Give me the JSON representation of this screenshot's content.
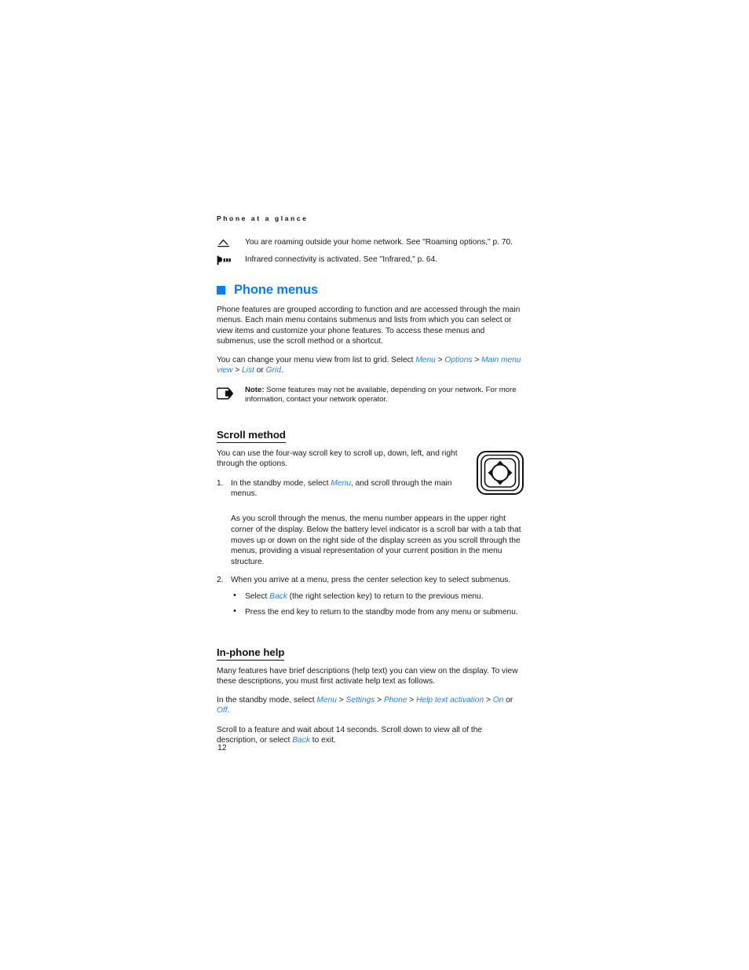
{
  "page": {
    "running_header": "Phone at a glance",
    "folio": "12"
  },
  "glance_items": [
    {
      "icon": "roaming-triangle-icon",
      "text": "You are roaming outside your home network. See \"Roaming options,\" p. 70."
    },
    {
      "icon": "infrared-icon",
      "text": "Infrared connectivity is activated. See \"Infrared,\" p. 64."
    }
  ],
  "section": {
    "title": "Phone menus",
    "bullet_color": "#0a7bf0",
    "title_color": "#0a7bf0",
    "intro": "Phone features are grouped according to function and are accessed through the main menus. Each main menu contains submenus and lists from which you can select or view items and customize your phone features. To access these menus and submenus, use the scroll method or a shortcut.",
    "menu_path_intro": "You can change your menu view from list to grid. Select ",
    "menu_path": {
      "item1": "Menu",
      "sep1": " > ",
      "item2": "Options",
      "sep2": " > ",
      "item3": "Main menu view",
      "sep3": " > ",
      "item4": "List",
      "sep4": " or ",
      "item5": "Grid",
      "end": "."
    }
  },
  "note": {
    "icon": "note-arrow-icon",
    "label": "Note:",
    "text": " Some features may not be available, depending on your network. For more information, contact your network operator."
  },
  "scroll_method": {
    "heading": "Scroll method",
    "intro": "You can use the four-way scroll key to scroll up, down, left, and right through the options.",
    "figure_name": "four-way-scroll-key-image",
    "steps": [
      {
        "num": "1.",
        "text_before": "In the standby mode, select ",
        "link": "Menu",
        "text_after": ", and scroll through the main menus."
      },
      {
        "num": "2.",
        "text_before": "When you arrive at a menu, press the center selection key to select submenus.",
        "link": "",
        "text_after": ""
      }
    ],
    "step1_detail": "As you scroll through the menus, the menu number appears in the upper right corner of the display. Below the battery level indicator is a scroll bar with a tab that moves up or down on the right side of the display screen as you scroll through the menus, providing a visual representation of your current position in the menu structure.",
    "bullets": [
      {
        "before": "Select ",
        "link": "Back",
        "after": " (the right selection key) to return to the previous menu."
      },
      {
        "before": "Press the end key to return to the standby mode from any menu or submenu.",
        "link": "",
        "after": ""
      }
    ]
  },
  "in_phone_help": {
    "heading": "In-phone help",
    "para1": "Many features have brief descriptions (help text) you can view on the display. To view these descriptions, you must first activate help text as follows.",
    "para2_intro": "In the standby mode, select ",
    "path": {
      "item1": "Menu",
      "sep1": " > ",
      "item2": "Settings",
      "sep2": " > ",
      "item3": "Phone",
      "sep3": " > ",
      "item4": "Help text activation",
      "sep4": " > ",
      "item5": "On",
      "sep5": " or ",
      "item6": "Off",
      "end": "."
    },
    "para3_before": "Scroll to a feature and wait about 14 seconds. Scroll down to view all of the description, or select ",
    "para3_link": "Back",
    "para3_after": " to exit."
  }
}
